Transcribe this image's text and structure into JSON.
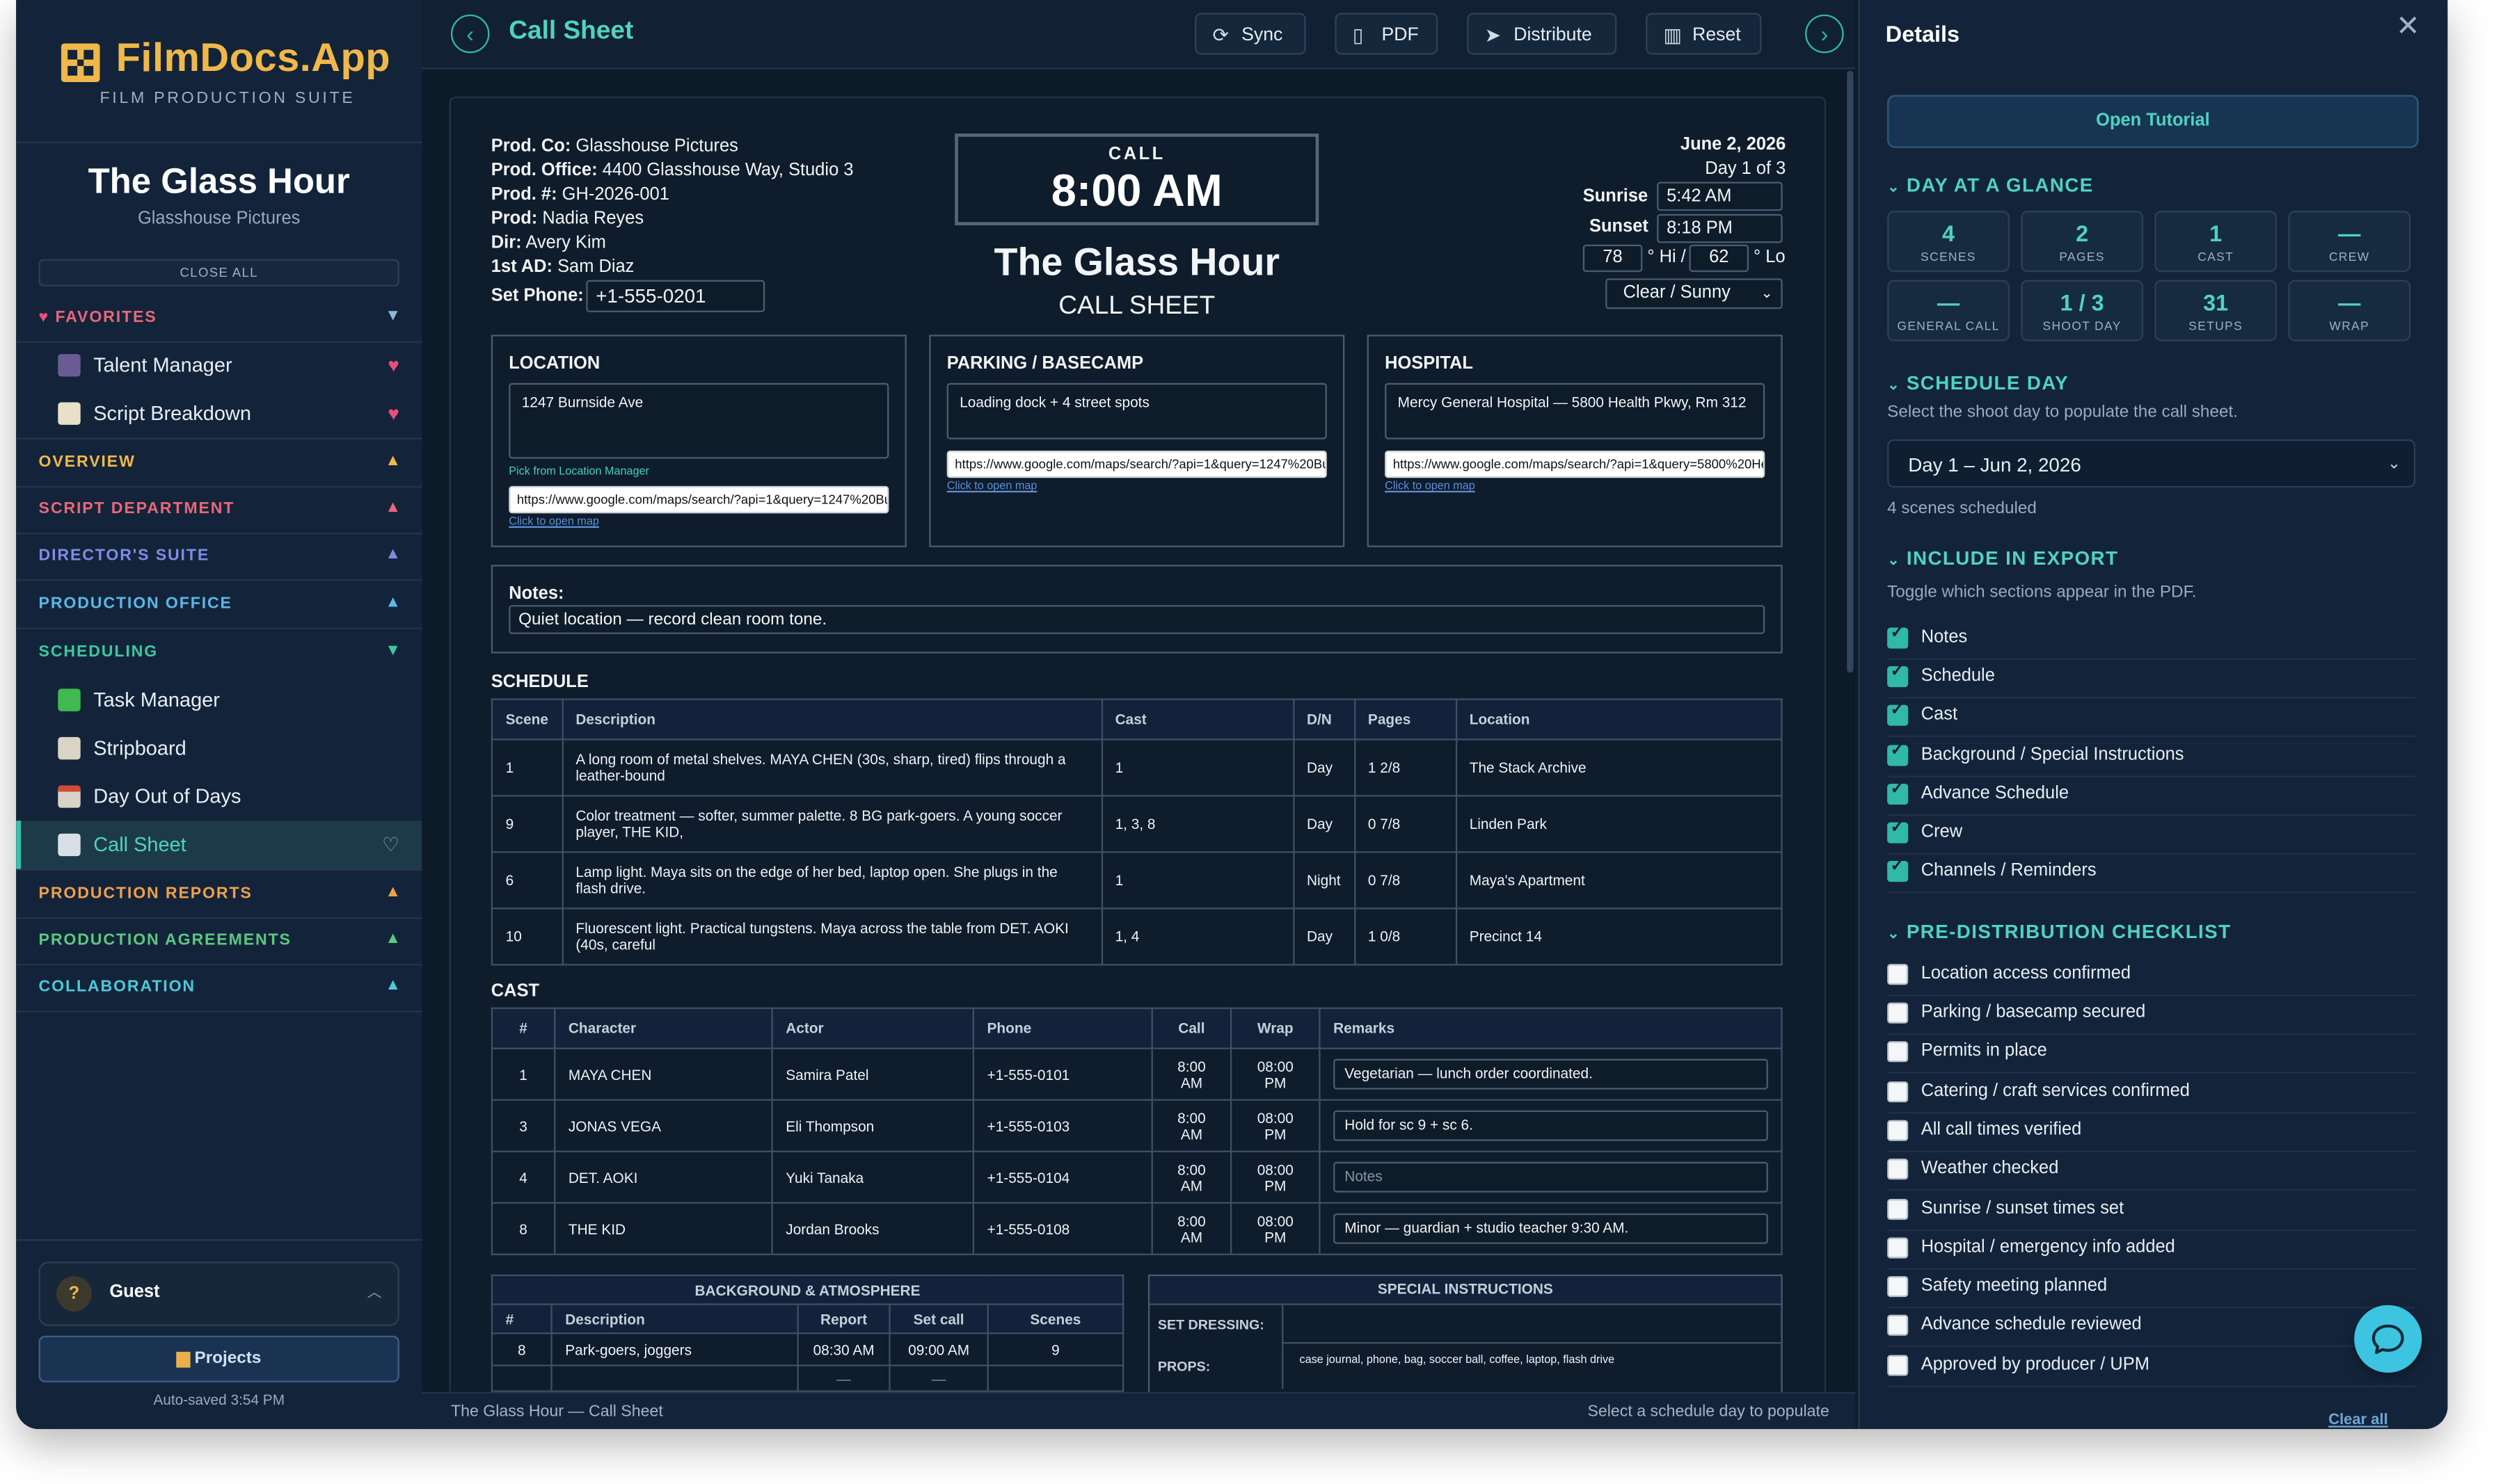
{
  "brand": {
    "name": "FilmDocs.App",
    "tagline": "FILM PRODUCTION SUITE"
  },
  "project": {
    "title": "The Glass Hour",
    "company": "Glasshouse Pictures"
  },
  "sidebar": {
    "close_all": "CLOSE ALL",
    "favorites": {
      "label": "FAVORITES",
      "items": [
        {
          "label": "Talent Manager"
        },
        {
          "label": "Script Breakdown"
        }
      ]
    },
    "sections": [
      {
        "label": "OVERVIEW",
        "color": "#f0b84a"
      },
      {
        "label": "SCRIPT DEPARTMENT",
        "color": "#e8677a"
      },
      {
        "label": "DIRECTOR'S SUITE",
        "color": "#7e8ce8"
      },
      {
        "label": "PRODUCTION OFFICE",
        "color": "#5ab8e8"
      },
      {
        "label": "SCHEDULING",
        "color": "#3cc8a0"
      }
    ],
    "scheduling_items": [
      {
        "label": "Task Manager"
      },
      {
        "label": "Stripboard"
      },
      {
        "label": "Day Out of Days"
      },
      {
        "label": "Call Sheet"
      }
    ],
    "sections_after": [
      {
        "label": "PRODUCTION REPORTS",
        "color": "#f0a04a"
      },
      {
        "label": "PRODUCTION AGREEMENTS",
        "color": "#5cc880"
      },
      {
        "label": "COLLABORATION",
        "color": "#4fc8d8"
      }
    ],
    "user": {
      "initial": "?",
      "name": "Guest"
    },
    "projects_button": "Projects",
    "autosave": "Auto-saved 3:54 PM"
  },
  "toolbar": {
    "title": "Call Sheet",
    "sync": "Sync",
    "pdf": "PDF",
    "distribute": "Distribute",
    "reset": "Reset"
  },
  "callsheet": {
    "info": [
      {
        "k": "Prod. Co:",
        "v": "Glasshouse Pictures"
      },
      {
        "k": "Prod. Office:",
        "v": "4400 Glasshouse Way, Studio 3"
      },
      {
        "k": "Prod. #:",
        "v": "GH-2026-001"
      },
      {
        "k": "Prod:",
        "v": "Nadia Reyes"
      },
      {
        "k": "Dir:",
        "v": "Avery Kim"
      },
      {
        "k": "1st AD:",
        "v": "Sam Diaz"
      }
    ],
    "set_phone_label": "Set Phone:",
    "set_phone": "+1-555-0201",
    "call_label": "CALL",
    "call_time": "8:00 AM",
    "title": "The Glass Hour",
    "subtitle": "CALL SHEET",
    "date": "June 2, 2026",
    "day_of": "Day 1 of 3",
    "sunrise_label": "Sunrise",
    "sunrise": "5:42 AM",
    "sunset_label": "Sunset",
    "sunset": "8:18 PM",
    "hi": "78",
    "hi_label": "° Hi /",
    "lo": "62",
    "lo_label": "° Lo",
    "weather": "Clear / Sunny",
    "location": {
      "label": "LOCATION",
      "address": "1247 Burnside Ave",
      "pick": "Pick from Location Manager",
      "url": "https://www.google.com/maps/search/?api=1&query=1247%20Bu",
      "link": "Click to open map"
    },
    "parking": {
      "label": "PARKING / BASECAMP",
      "text": "Loading dock + 4 street spots",
      "url": "https://www.google.com/maps/search/?api=1&query=1247%20Bu",
      "link": "Click to open map"
    },
    "hospital": {
      "label": "HOSPITAL",
      "text": "Mercy General Hospital — 5800 Health Pkwy, Rm 312",
      "url": "https://www.google.com/maps/search/?api=1&query=5800%20He",
      "link": "Click to open map"
    },
    "notes_label": "Notes:",
    "notes": "Quiet location — record clean room tone.",
    "schedule_label": "SCHEDULE",
    "schedule_headers": [
      "Scene",
      "Description",
      "Cast",
      "D/N",
      "Pages",
      "Location"
    ],
    "schedule": [
      {
        "scene": "1",
        "desc": "A long room of metal shelves. MAYA CHEN (30s, sharp, tired) flips through a leather-bound",
        "cast": "1",
        "dn": "Day",
        "pages": "1 2/8",
        "loc": "The Stack Archive"
      },
      {
        "scene": "9",
        "desc": "Color treatment — softer, summer palette. 8 BG park-goers. A young soccer player, THE KID,",
        "cast": "1, 3, 8",
        "dn": "Day",
        "pages": "0 7/8",
        "loc": "Linden Park"
      },
      {
        "scene": "6",
        "desc": "Lamp light. Maya sits on the edge of her bed, laptop open. She plugs in the flash drive.",
        "cast": "1",
        "dn": "Night",
        "pages": "0 7/8",
        "loc": "Maya's Apartment"
      },
      {
        "scene": "10",
        "desc": "Fluorescent light. Practical tungstens. Maya across the table from DET. AOKI (40s, careful",
        "cast": "1, 4",
        "dn": "Day",
        "pages": "1 0/8",
        "loc": "Precinct 14"
      }
    ],
    "cast_label": "CAST",
    "cast_headers": [
      "#",
      "Character",
      "Actor",
      "Phone",
      "Call",
      "Wrap",
      "Remarks"
    ],
    "cast": [
      {
        "num": "1",
        "character": "MAYA CHEN",
        "actor": "Samira Patel",
        "phone": "+1-555-0101",
        "call": "8:00 AM",
        "wrap": "08:00 PM",
        "remarks": "Vegetarian — lunch order coordinated."
      },
      {
        "num": "3",
        "character": "JONAS VEGA",
        "actor": "Eli Thompson",
        "phone": "+1-555-0103",
        "call": "8:00 AM",
        "wrap": "08:00 PM",
        "remarks": "Hold for sc 9 + sc 6."
      },
      {
        "num": "4",
        "character": "DET. AOKI",
        "actor": "Yuki Tanaka",
        "phone": "+1-555-0104",
        "call": "8:00 AM",
        "wrap": "08:00 PM",
        "remarks": "",
        "remarks_placeholder": "Notes"
      },
      {
        "num": "8",
        "character": "THE KID",
        "actor": "Jordan Brooks",
        "phone": "+1-555-0108",
        "call": "8:00 AM",
        "wrap": "08:00 PM",
        "remarks": "Minor — guardian + studio teacher 9:30 AM."
      }
    ],
    "bg_label": "BACKGROUND & ATMOSPHERE",
    "bg_headers": [
      "#",
      "Description",
      "Report",
      "Set call",
      "Scenes"
    ],
    "bg_rows": [
      {
        "num": "8",
        "desc": "Park-goers, joggers",
        "report": "08:30 AM",
        "setcall": "09:00 AM",
        "scenes": "9"
      },
      {
        "num": "",
        "desc": "",
        "report": "—",
        "setcall": "—",
        "scenes": ""
      }
    ],
    "special_label": "SPECIAL INSTRUCTIONS",
    "set_dressing_label": "SET DRESSING:",
    "set_dressing": "",
    "props_label": "PROPS:",
    "props": "case journal, phone, bag, soccer ball, coffee, laptop, flash drive"
  },
  "statusbar": {
    "left": "The Glass Hour — Call Sheet",
    "right": "Select a schedule day to populate"
  },
  "details": {
    "title": "Details",
    "tutorial": "Open Tutorial",
    "glance_label": "DAY AT A GLANCE",
    "stats": [
      {
        "value": "4",
        "label": "SCENES"
      },
      {
        "value": "2",
        "label": "PAGES"
      },
      {
        "value": "1",
        "label": "CAST"
      },
      {
        "value": "—",
        "label": "CREW"
      },
      {
        "value": "—",
        "label": "GENERAL CALL"
      },
      {
        "value": "1 / 3",
        "label": "SHOOT DAY"
      },
      {
        "value": "31",
        "label": "SETUPS"
      },
      {
        "value": "—",
        "label": "WRAP"
      }
    ],
    "schedule_day_label": "SCHEDULE DAY",
    "schedule_day_desc": "Select the shoot day to populate the call sheet.",
    "selected_day": "Day 1 – Jun 2, 2026",
    "scenes_scheduled": "4 scenes scheduled",
    "export_label": "INCLUDE IN EXPORT",
    "export_desc": "Toggle which sections appear in the PDF.",
    "export_items": [
      {
        "label": "Notes",
        "checked": true
      },
      {
        "label": "Schedule",
        "checked": true
      },
      {
        "label": "Cast",
        "checked": true
      },
      {
        "label": "Background / Special Instructions",
        "checked": true
      },
      {
        "label": "Advance Schedule",
        "checked": true
      },
      {
        "label": "Crew",
        "checked": true
      },
      {
        "label": "Channels / Reminders",
        "checked": true
      }
    ],
    "checklist_label": "PRE-DISTRIBUTION CHECKLIST",
    "checklist": [
      {
        "label": "Location access confirmed",
        "checked": false
      },
      {
        "label": "Parking / basecamp secured",
        "checked": false
      },
      {
        "label": "Permits in place",
        "checked": false
      },
      {
        "label": "Catering / craft services confirmed",
        "checked": false
      },
      {
        "label": "All call times verified",
        "checked": false
      },
      {
        "label": "Weather checked",
        "checked": false
      },
      {
        "label": "Sunrise / sunset times set",
        "checked": false
      },
      {
        "label": "Hospital / emergency info added",
        "checked": false
      },
      {
        "label": "Safety meeting planned",
        "checked": false
      },
      {
        "label": "Advance schedule reviewed",
        "checked": false
      },
      {
        "label": "Approved by producer / UPM",
        "checked": false
      }
    ],
    "clear_all": "Clear all"
  },
  "colors": {
    "accent": "#4fd3c0",
    "brand": "#f0b84a",
    "favorite": "#e8507a"
  }
}
